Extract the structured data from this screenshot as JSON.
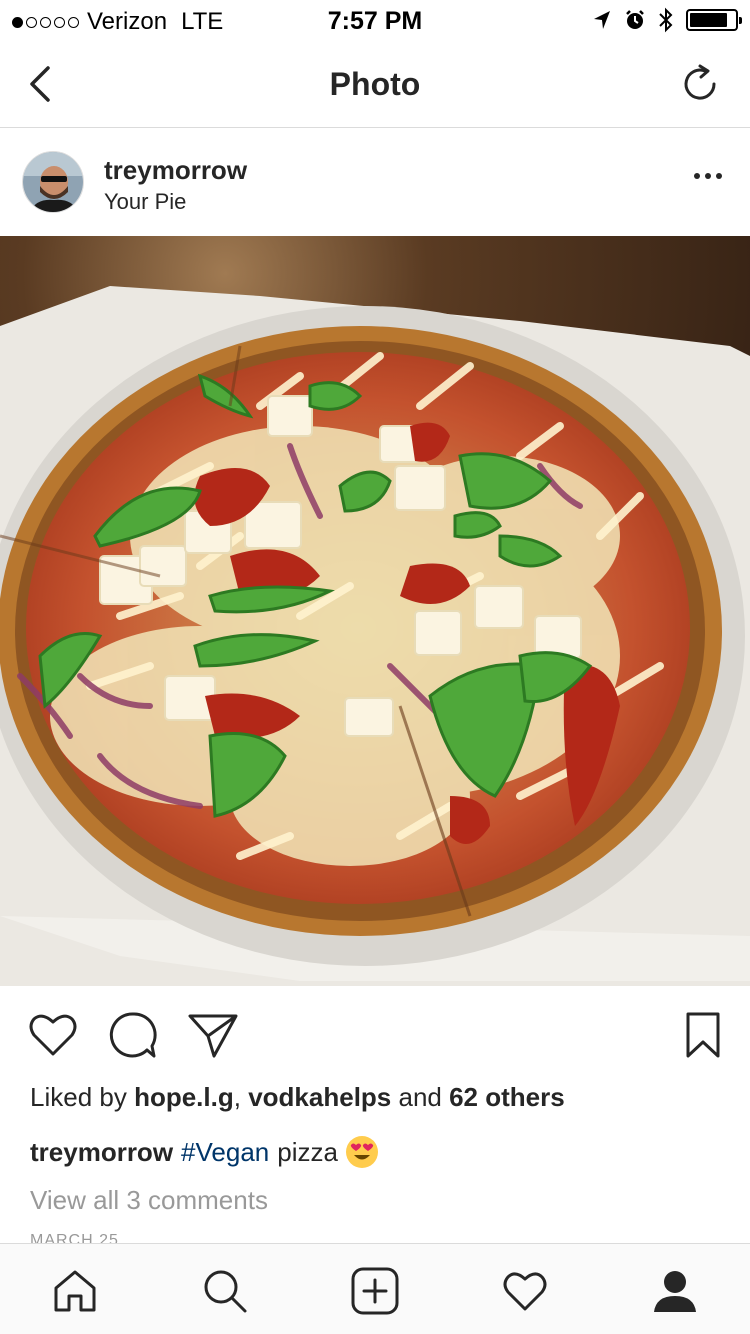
{
  "status_bar": {
    "carrier": "Verizon",
    "network": "LTE",
    "time": "7:57 PM",
    "signal_bars_filled": 1,
    "signal_bars_total": 5,
    "battery_level": 0.85
  },
  "nav": {
    "title": "Photo",
    "back_icon": "chevron-left-icon",
    "refresh_icon": "refresh-icon"
  },
  "post": {
    "username": "treymorrow",
    "location": "Your Pie",
    "photo_description_icon": "photo"
  },
  "engagement": {
    "liked_by_prefix": "Liked by ",
    "liked_user_1": "hope.l.g",
    "separator": ", ",
    "liked_user_2": "vodkahelps",
    "and_text": " and ",
    "others": "62 others"
  },
  "caption": {
    "username": "treymorrow",
    "hashtag": "#Vegan",
    "text": "pizza",
    "emoji": "heart-eyes-emoji"
  },
  "comments_link": "View all 3 comments",
  "date": "MARCH 25",
  "tabs": [
    "home-icon",
    "search-icon",
    "add-post-icon",
    "activity-heart-icon",
    "profile-icon"
  ],
  "colors": {
    "text": "#262626",
    "muted": "#999999",
    "hashtag": "#003569",
    "divider": "#dbdbdb"
  }
}
